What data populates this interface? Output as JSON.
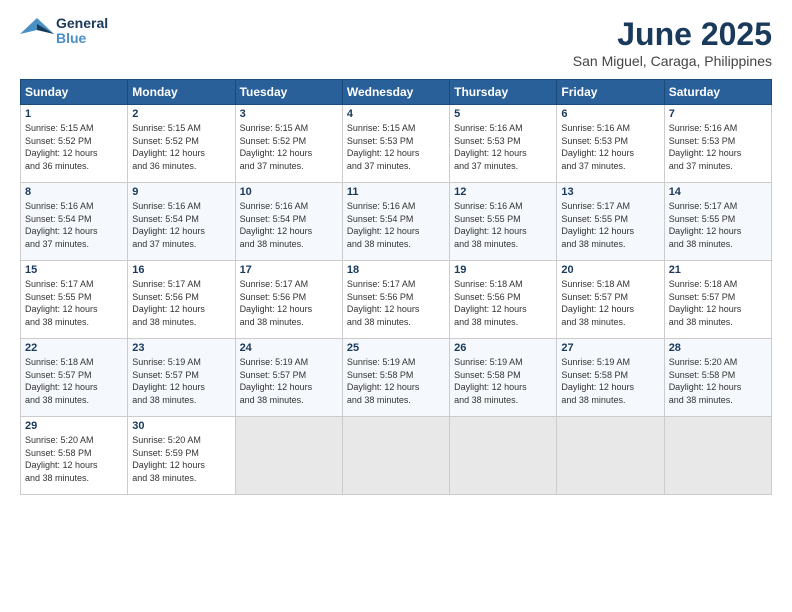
{
  "header": {
    "logo_line1": "General",
    "logo_line2": "Blue",
    "month": "June 2025",
    "location": "San Miguel, Caraga, Philippines"
  },
  "weekdays": [
    "Sunday",
    "Monday",
    "Tuesday",
    "Wednesday",
    "Thursday",
    "Friday",
    "Saturday"
  ],
  "weeks": [
    [
      {
        "day": "1",
        "info": "Sunrise: 5:15 AM\nSunset: 5:52 PM\nDaylight: 12 hours\nand 36 minutes."
      },
      {
        "day": "2",
        "info": "Sunrise: 5:15 AM\nSunset: 5:52 PM\nDaylight: 12 hours\nand 36 minutes."
      },
      {
        "day": "3",
        "info": "Sunrise: 5:15 AM\nSunset: 5:52 PM\nDaylight: 12 hours\nand 37 minutes."
      },
      {
        "day": "4",
        "info": "Sunrise: 5:15 AM\nSunset: 5:53 PM\nDaylight: 12 hours\nand 37 minutes."
      },
      {
        "day": "5",
        "info": "Sunrise: 5:16 AM\nSunset: 5:53 PM\nDaylight: 12 hours\nand 37 minutes."
      },
      {
        "day": "6",
        "info": "Sunrise: 5:16 AM\nSunset: 5:53 PM\nDaylight: 12 hours\nand 37 minutes."
      },
      {
        "day": "7",
        "info": "Sunrise: 5:16 AM\nSunset: 5:53 PM\nDaylight: 12 hours\nand 37 minutes."
      }
    ],
    [
      {
        "day": "8",
        "info": "Sunrise: 5:16 AM\nSunset: 5:54 PM\nDaylight: 12 hours\nand 37 minutes."
      },
      {
        "day": "9",
        "info": "Sunrise: 5:16 AM\nSunset: 5:54 PM\nDaylight: 12 hours\nand 37 minutes."
      },
      {
        "day": "10",
        "info": "Sunrise: 5:16 AM\nSunset: 5:54 PM\nDaylight: 12 hours\nand 38 minutes."
      },
      {
        "day": "11",
        "info": "Sunrise: 5:16 AM\nSunset: 5:54 PM\nDaylight: 12 hours\nand 38 minutes."
      },
      {
        "day": "12",
        "info": "Sunrise: 5:16 AM\nSunset: 5:55 PM\nDaylight: 12 hours\nand 38 minutes."
      },
      {
        "day": "13",
        "info": "Sunrise: 5:17 AM\nSunset: 5:55 PM\nDaylight: 12 hours\nand 38 minutes."
      },
      {
        "day": "14",
        "info": "Sunrise: 5:17 AM\nSunset: 5:55 PM\nDaylight: 12 hours\nand 38 minutes."
      }
    ],
    [
      {
        "day": "15",
        "info": "Sunrise: 5:17 AM\nSunset: 5:55 PM\nDaylight: 12 hours\nand 38 minutes."
      },
      {
        "day": "16",
        "info": "Sunrise: 5:17 AM\nSunset: 5:56 PM\nDaylight: 12 hours\nand 38 minutes."
      },
      {
        "day": "17",
        "info": "Sunrise: 5:17 AM\nSunset: 5:56 PM\nDaylight: 12 hours\nand 38 minutes."
      },
      {
        "day": "18",
        "info": "Sunrise: 5:17 AM\nSunset: 5:56 PM\nDaylight: 12 hours\nand 38 minutes."
      },
      {
        "day": "19",
        "info": "Sunrise: 5:18 AM\nSunset: 5:56 PM\nDaylight: 12 hours\nand 38 minutes."
      },
      {
        "day": "20",
        "info": "Sunrise: 5:18 AM\nSunset: 5:57 PM\nDaylight: 12 hours\nand 38 minutes."
      },
      {
        "day": "21",
        "info": "Sunrise: 5:18 AM\nSunset: 5:57 PM\nDaylight: 12 hours\nand 38 minutes."
      }
    ],
    [
      {
        "day": "22",
        "info": "Sunrise: 5:18 AM\nSunset: 5:57 PM\nDaylight: 12 hours\nand 38 minutes."
      },
      {
        "day": "23",
        "info": "Sunrise: 5:19 AM\nSunset: 5:57 PM\nDaylight: 12 hours\nand 38 minutes."
      },
      {
        "day": "24",
        "info": "Sunrise: 5:19 AM\nSunset: 5:57 PM\nDaylight: 12 hours\nand 38 minutes."
      },
      {
        "day": "25",
        "info": "Sunrise: 5:19 AM\nSunset: 5:58 PM\nDaylight: 12 hours\nand 38 minutes."
      },
      {
        "day": "26",
        "info": "Sunrise: 5:19 AM\nSunset: 5:58 PM\nDaylight: 12 hours\nand 38 minutes."
      },
      {
        "day": "27",
        "info": "Sunrise: 5:19 AM\nSunset: 5:58 PM\nDaylight: 12 hours\nand 38 minutes."
      },
      {
        "day": "28",
        "info": "Sunrise: 5:20 AM\nSunset: 5:58 PM\nDaylight: 12 hours\nand 38 minutes."
      }
    ],
    [
      {
        "day": "29",
        "info": "Sunrise: 5:20 AM\nSunset: 5:58 PM\nDaylight: 12 hours\nand 38 minutes."
      },
      {
        "day": "30",
        "info": "Sunrise: 5:20 AM\nSunset: 5:59 PM\nDaylight: 12 hours\nand 38 minutes."
      },
      {
        "day": "",
        "info": ""
      },
      {
        "day": "",
        "info": ""
      },
      {
        "day": "",
        "info": ""
      },
      {
        "day": "",
        "info": ""
      },
      {
        "day": "",
        "info": ""
      }
    ]
  ]
}
